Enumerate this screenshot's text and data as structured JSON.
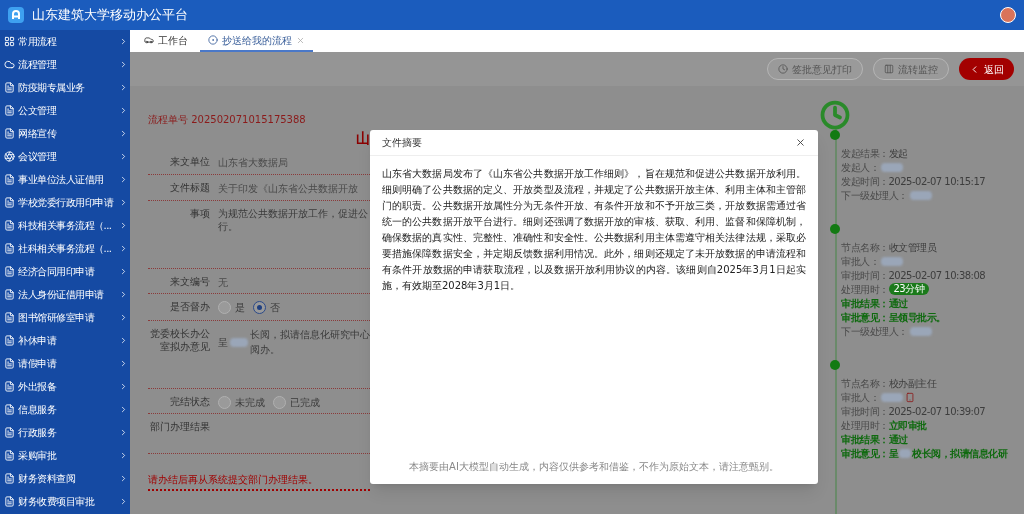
{
  "app": {
    "title": "山东建筑大学移动办公平台"
  },
  "sidebar": {
    "items": [
      {
        "label": "常用流程",
        "kind": "grid"
      },
      {
        "label": "流程管理",
        "kind": "cloud"
      },
      {
        "label": "防疫期专属业务",
        "kind": "document"
      },
      {
        "label": "公文管理",
        "kind": "document"
      },
      {
        "label": "网络宣传",
        "kind": "document"
      },
      {
        "label": "会议管理",
        "kind": "meeting"
      },
      {
        "label": "事业单位法人证借用",
        "kind": "document"
      },
      {
        "label": "学校党委行政用印申请",
        "kind": "document"
      },
      {
        "label": "科技相关事务流程（...",
        "kind": "document"
      },
      {
        "label": "社科相关事务流程（...",
        "kind": "document"
      },
      {
        "label": "经济合同用印申请",
        "kind": "document"
      },
      {
        "label": "法人身份证借用申请",
        "kind": "document"
      },
      {
        "label": "图书馆研修室申请",
        "kind": "document"
      },
      {
        "label": "补休申请",
        "kind": "document"
      },
      {
        "label": "请假申请",
        "kind": "document"
      },
      {
        "label": "外出报备",
        "kind": "document"
      },
      {
        "label": "信息服务",
        "kind": "document"
      },
      {
        "label": "行政服务",
        "kind": "document"
      },
      {
        "label": "采购审批",
        "kind": "document"
      },
      {
        "label": "财务资料查阅",
        "kind": "document"
      },
      {
        "label": "财务收费项目审批",
        "kind": "document"
      }
    ]
  },
  "tabs": [
    {
      "label": "工作台",
      "kind": "dashboard",
      "selected": false,
      "closable": false
    },
    {
      "label": "抄送给我的流程",
      "kind": "flow",
      "selected": true,
      "closable": true
    }
  ],
  "toolbar": {
    "buttons": [
      {
        "label": "签批意见打印",
        "kind": "print"
      },
      {
        "label": "流转监控",
        "kind": "monitor"
      },
      {
        "label": "返回",
        "kind": "back"
      }
    ]
  },
  "form": {
    "serial": "流程单号 202502071015175388",
    "title": "山",
    "fields": [
      {
        "label": "来文单位",
        "kind": "text",
        "value": "山东省大数据局"
      },
      {
        "label": "文件标题",
        "kind": "text",
        "value": "关于印发《山东省公共数据开放"
      },
      {
        "label": "事项",
        "kind": "multiline",
        "lines": [
          "为规范公共数据开放工作，促进公",
          "行。"
        ]
      },
      {
        "label": "来文编号",
        "kind": "text",
        "value": "无"
      },
      {
        "label": "是否督办",
        "kind": "radio",
        "options": [
          {
            "label": "是",
            "selected": false
          },
          {
            "label": "否",
            "selected": true
          }
        ]
      },
      {
        "label": "党委校长办公室拟办意见",
        "kind": "opinion",
        "before": "呈",
        "redacted": true,
        "value": "长阅，拟请信息化研究中心阅办。"
      },
      {
        "label": "完结状态",
        "kind": "radio",
        "options": [
          {
            "label": "未完成",
            "selected": false
          },
          {
            "label": "已完成",
            "selected": false
          }
        ]
      },
      {
        "label": "部门办理结果",
        "kind": "empty"
      }
    ],
    "note": "请办结后再从系统提交部门办理结果。"
  },
  "modal": {
    "title": "文件摘要",
    "body": "山东省大数据局发布了《山东省公共数据开放工作细则》，旨在规范和促进公共数据开放利用。细则明确了公共数据的定义、开放类型及流程，并规定了公共数据开放主体、利用主体和主管部门的职责。公共数据开放属性分为无条件开放、有条件开放和不予开放三类，开放数据需通过省统一的公共数据开放平台进行。细则还强调了数据开放的审核、获取、利用、监督和保障机制，确保数据的真实性、完整性、准确性和安全性。公共数据利用主体需遵守相关法律法规，采取必要措施保障数据安全，并定期反馈数据利用情况。此外，细则还规定了未开放数据的申请流程和有条件开放数据的申请获取流程，以及数据开放利用协议的内容。该细则自2025年3月1日起实施，有效期至2028年3月1日。",
    "footer": "本摘要由AI大模型自动生成，内容仅供参考和借鉴，不作为原始文本，请注意甄别。"
  },
  "timeline": [
    {
      "lines": [
        {
          "label": "发起结果：",
          "kind": "text",
          "value": "发起",
          "highlight": false
        },
        {
          "label": "发起人：",
          "kind": "redacted",
          "highlight": false,
          "phone": false
        },
        {
          "label": "发起时间：",
          "kind": "text",
          "value": "2025-02-07 10:15:17",
          "highlight": false
        },
        {
          "label": "下一级处理人：",
          "kind": "redacted",
          "highlight": false,
          "phone": false
        }
      ]
    },
    {
      "lines": [
        {
          "label": "节点名称：",
          "kind": "text",
          "value": "收文管理员",
          "highlight": false
        },
        {
          "label": "审批人：",
          "kind": "redacted",
          "highlight": false,
          "phone": false
        },
        {
          "label": "审批时间：",
          "kind": "text",
          "value": "2025-02-07 10:38:08",
          "highlight": false
        },
        {
          "label": "处理用时：",
          "kind": "badge",
          "value": "23分钟",
          "highlight": false
        },
        {
          "label": "审批结果：",
          "kind": "text",
          "value": "通过",
          "highlight": true
        },
        {
          "label": "审批意见：",
          "kind": "text",
          "value": "呈领导批示。",
          "highlight": true
        },
        {
          "label": "下一级处理人：",
          "kind": "redacted",
          "highlight": false,
          "phone": false
        }
      ]
    },
    {
      "lines": [
        {
          "label": "节点名称：",
          "kind": "text",
          "value": "校办副主任",
          "highlight": false
        },
        {
          "label": "审批人：",
          "kind": "redacted",
          "highlight": false,
          "phone": true
        },
        {
          "label": "审批时间：",
          "kind": "text",
          "value": "2025-02-07 10:39:07",
          "highlight": false
        },
        {
          "label": "处理用时：",
          "kind": "strong",
          "value": "立即审批",
          "highlight": false
        },
        {
          "label": "审批结果：",
          "kind": "text",
          "value": "通过",
          "highlight": true
        },
        {
          "label": "审批意见：",
          "kind": "opinion",
          "before": "呈",
          "value": "校长阅，拟请信息化研",
          "highlight": true
        }
      ]
    }
  ]
}
